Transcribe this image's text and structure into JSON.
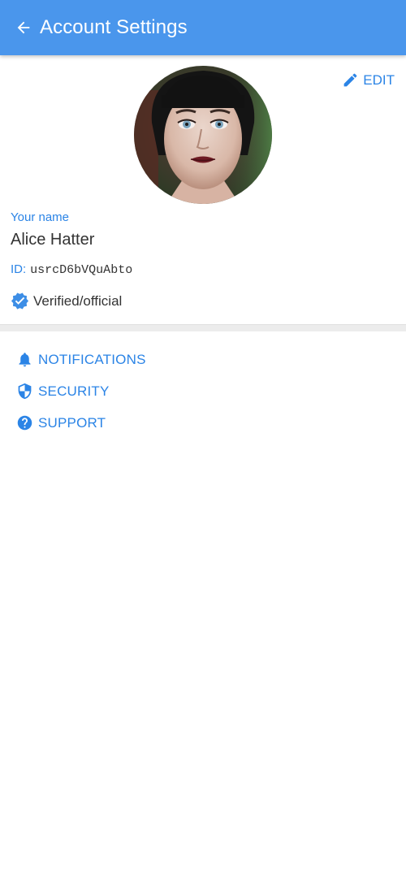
{
  "header": {
    "title": "Account Settings",
    "back_icon": "arrow-left-icon",
    "color": "#4a96ec"
  },
  "profile": {
    "edit_label": "EDIT",
    "edit_icon": "pencil-icon",
    "name_label": "Your name",
    "name": "Alice Hatter",
    "id_label": "ID:",
    "id_value": "usrcD6bVQuAbto",
    "verified_label": "Verified/official",
    "verified_icon": "verified-badge-icon"
  },
  "menu": {
    "items": [
      {
        "label": "NOTIFICATIONS",
        "icon": "bell-icon"
      },
      {
        "label": "SECURITY",
        "icon": "shield-icon"
      },
      {
        "label": "SUPPORT",
        "icon": "help-circle-icon"
      }
    ]
  },
  "colors": {
    "accent": "#2b84e6",
    "appbar": "#4a96ec",
    "divider": "#ececec"
  }
}
